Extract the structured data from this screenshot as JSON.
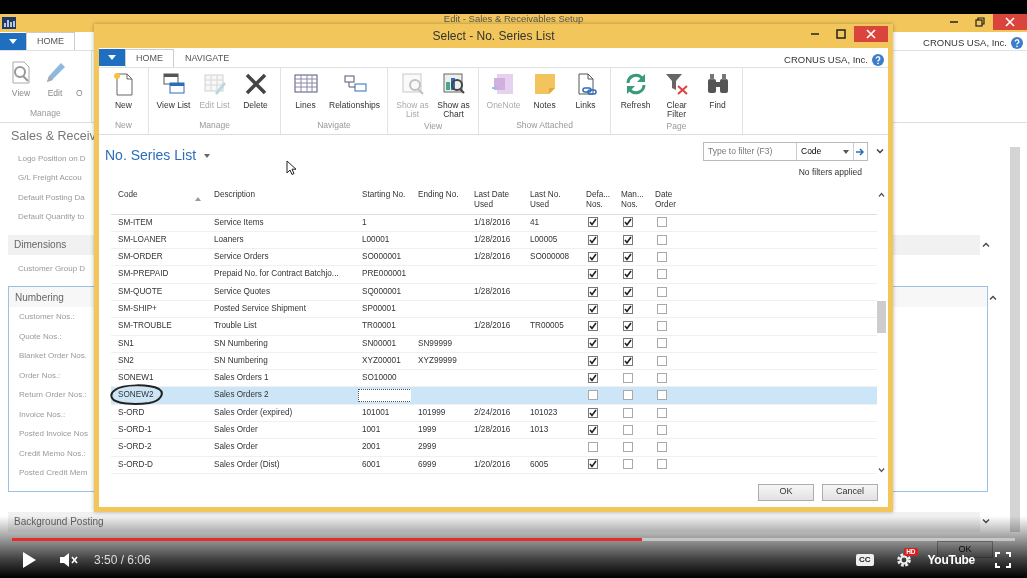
{
  "app_window": {
    "title": "Edit - Sales & Receivables Setup",
    "tabs": [
      {
        "label": "HOME",
        "selected": true
      }
    ],
    "ribbon": [
      {
        "group": "Manage",
        "buttons": [
          {
            "label": "View"
          },
          {
            "label": "Edit"
          },
          {
            "label": "O"
          }
        ]
      }
    ],
    "company": "CRONUS USA, Inc.",
    "page_title": "Sales & Receiv",
    "fields": [
      "Logo Position on D",
      "G/L Freight Accou",
      "Default Posting Da",
      "Default Quantity to"
    ],
    "sections": [
      {
        "title": "Dimensions",
        "expanded": true,
        "focused": false,
        "fields": [
          "Customer Group D"
        ]
      },
      {
        "title": "Numbering",
        "expanded": true,
        "focused": true,
        "fields": [
          "Customer Nos.:",
          "Quote Nos.:",
          "Blanket Order Nos.",
          "Order Nos.:",
          "Return Order Nos.:",
          "Invoice Nos.:",
          "Posted Invoice Nos",
          "Credit Memo Nos.:",
          "Posted Credit Mem"
        ]
      },
      {
        "title": "Background Posting",
        "expanded": false,
        "focused": false
      }
    ],
    "buttons": [
      "OK"
    ]
  },
  "dialog": {
    "title": "Select - No. Series List",
    "tabs": [
      {
        "label": "HOME",
        "selected": true
      },
      {
        "label": "NAVIGATE",
        "selected": false
      }
    ],
    "company": "CRONUS USA, Inc.",
    "ribbon": [
      {
        "group": "New",
        "buttons": [
          {
            "label": "New",
            "disabled": false
          }
        ]
      },
      {
        "group": "Manage",
        "buttons": [
          {
            "label": "View List",
            "disabled": false
          },
          {
            "label": "Edit List",
            "disabled": true
          },
          {
            "label": "Delete",
            "disabled": false
          }
        ]
      },
      {
        "group": "Navigate",
        "buttons": [
          {
            "label": "Lines",
            "disabled": false
          },
          {
            "label": "Relationships",
            "disabled": false
          }
        ]
      },
      {
        "group": "View",
        "buttons": [
          {
            "label": "Show as List",
            "disabled": true
          },
          {
            "label": "Show as Chart",
            "disabled": false
          }
        ]
      },
      {
        "group": "Show Attached",
        "buttons": [
          {
            "label": "OneNote",
            "disabled": true
          },
          {
            "label": "Notes",
            "disabled": false
          },
          {
            "label": "Links",
            "disabled": false
          }
        ]
      },
      {
        "group": "Page",
        "buttons": [
          {
            "label": "Refresh",
            "disabled": false
          },
          {
            "label": "Clear Filter",
            "disabled": false
          },
          {
            "label": "Find",
            "disabled": false
          }
        ]
      }
    ],
    "page_title": "No. Series List",
    "filter": {
      "placeholder": "Type to filter (F3)",
      "field": "Code"
    },
    "filter_status": "No filters applied",
    "table": {
      "columns": [
        {
          "label": "Code",
          "sorted": true
        },
        {
          "label": "Description",
          "sorted": false
        },
        {
          "label": "Starting No.",
          "sorted": false
        },
        {
          "label": "Ending No.",
          "sorted": false
        },
        {
          "label": "Last Date Used",
          "sorted": false
        },
        {
          "label": "Last No. Used",
          "sorted": false
        },
        {
          "label": "Defa... Nos.",
          "sorted": false
        },
        {
          "label": "Man... Nos.",
          "sorted": false
        },
        {
          "label": "Date Order",
          "sorted": false
        }
      ],
      "rows": [
        {
          "code": "SM-ITEM",
          "description": "Service Items",
          "starting_no": "1",
          "last_date_used": "1/18/2016",
          "last_no_used": "41",
          "default_nos": true,
          "manual_nos": true,
          "date_order": false,
          "selected": false,
          "editing": false,
          "circled": false
        },
        {
          "code": "SM-LOANER",
          "description": "Loaners",
          "starting_no": "L00001",
          "last_date_used": "1/28/2016",
          "last_no_used": "L00005",
          "default_nos": true,
          "manual_nos": true,
          "date_order": false,
          "selected": false,
          "editing": false,
          "circled": false
        },
        {
          "code": "SM-ORDER",
          "description": "Service Orders",
          "starting_no": "SO000001",
          "last_date_used": "1/28/2016",
          "last_no_used": "SO000008",
          "default_nos": true,
          "manual_nos": true,
          "date_order": false,
          "selected": false,
          "editing": false,
          "circled": false
        },
        {
          "code": "SM-PREPAID",
          "description": "Prepaid No. for Contract Batchjo...",
          "starting_no": "PRE000001",
          "default_nos": true,
          "manual_nos": true,
          "date_order": false,
          "selected": false,
          "editing": false,
          "circled": false
        },
        {
          "code": "SM-QUOTE",
          "description": "Service Quotes",
          "starting_no": "SQ000001",
          "last_date_used": "1/28/2016",
          "default_nos": true,
          "manual_nos": true,
          "date_order": false,
          "selected": false,
          "editing": false,
          "circled": false
        },
        {
          "code": "SM-SHIP+",
          "description": "Posted Service Shipment",
          "starting_no": "SP00001",
          "default_nos": true,
          "manual_nos": true,
          "date_order": false,
          "selected": false,
          "editing": false,
          "circled": false
        },
        {
          "code": "SM-TROUBLE",
          "description": "Trouble List",
          "starting_no": "TR00001",
          "last_date_used": "1/28/2016",
          "last_no_used": "TR00005",
          "default_nos": true,
          "manual_nos": true,
          "date_order": false,
          "selected": false,
          "editing": false,
          "circled": false
        },
        {
          "code": "SN1",
          "description": "SN Numbering",
          "starting_no": "SN00001",
          "ending_no": "SN99999",
          "default_nos": true,
          "manual_nos": true,
          "date_order": false,
          "selected": false,
          "editing": false,
          "circled": false
        },
        {
          "code": "SN2",
          "description": "SN Numbering",
          "starting_no": "XYZ00001",
          "ending_no": "XYZ99999",
          "default_nos": true,
          "manual_nos": true,
          "date_order": false,
          "selected": false,
          "editing": false,
          "circled": false
        },
        {
          "code": "SONEW1",
          "description": "Sales Orders 1",
          "starting_no": "SO10000",
          "default_nos": true,
          "manual_nos": false,
          "date_order": false,
          "selected": false,
          "editing": false,
          "circled": false
        },
        {
          "code": "SONEW2",
          "description": "Sales Orders 2",
          "default_nos": false,
          "manual_nos": false,
          "date_order": false,
          "selected": true,
          "editing": true,
          "circled": true
        },
        {
          "code": "S-ORD",
          "description": "Sales Order (expired)",
          "starting_no": "101001",
          "ending_no": "101999",
          "last_date_used": "2/24/2016",
          "last_no_used": "101023",
          "default_nos": true,
          "manual_nos": false,
          "date_order": false,
          "selected": false,
          "editing": false,
          "circled": false
        },
        {
          "code": "S-ORD-1",
          "description": "Sales Order",
          "starting_no": "1001",
          "ending_no": "1999",
          "last_date_used": "1/28/2016",
          "last_no_used": "1013",
          "default_nos": true,
          "manual_nos": false,
          "date_order": false,
          "selected": false,
          "editing": false,
          "circled": false
        },
        {
          "code": "S-ORD-2",
          "description": "Sales Order",
          "starting_no": "2001",
          "ending_no": "2999",
          "default_nos": false,
          "manual_nos": false,
          "date_order": false,
          "selected": false,
          "editing": false,
          "circled": false
        },
        {
          "code": "S-ORD-D",
          "description": "Sales Order (Dist)",
          "starting_no": "6001",
          "ending_no": "6999",
          "last_date_used": "1/20/2016",
          "last_no_used": "6005",
          "default_nos": true,
          "manual_nos": false,
          "date_order": false,
          "selected": false,
          "editing": false,
          "circled": false
        }
      ]
    },
    "buttons": [
      "OK",
      "Cancel"
    ]
  },
  "video": {
    "playing": false,
    "muted": true,
    "progress": {
      "level": 0.628
    },
    "time": "3:50 / 6:06",
    "captions": "CC",
    "quality_badge": "HD",
    "logo": "YouTube"
  }
}
